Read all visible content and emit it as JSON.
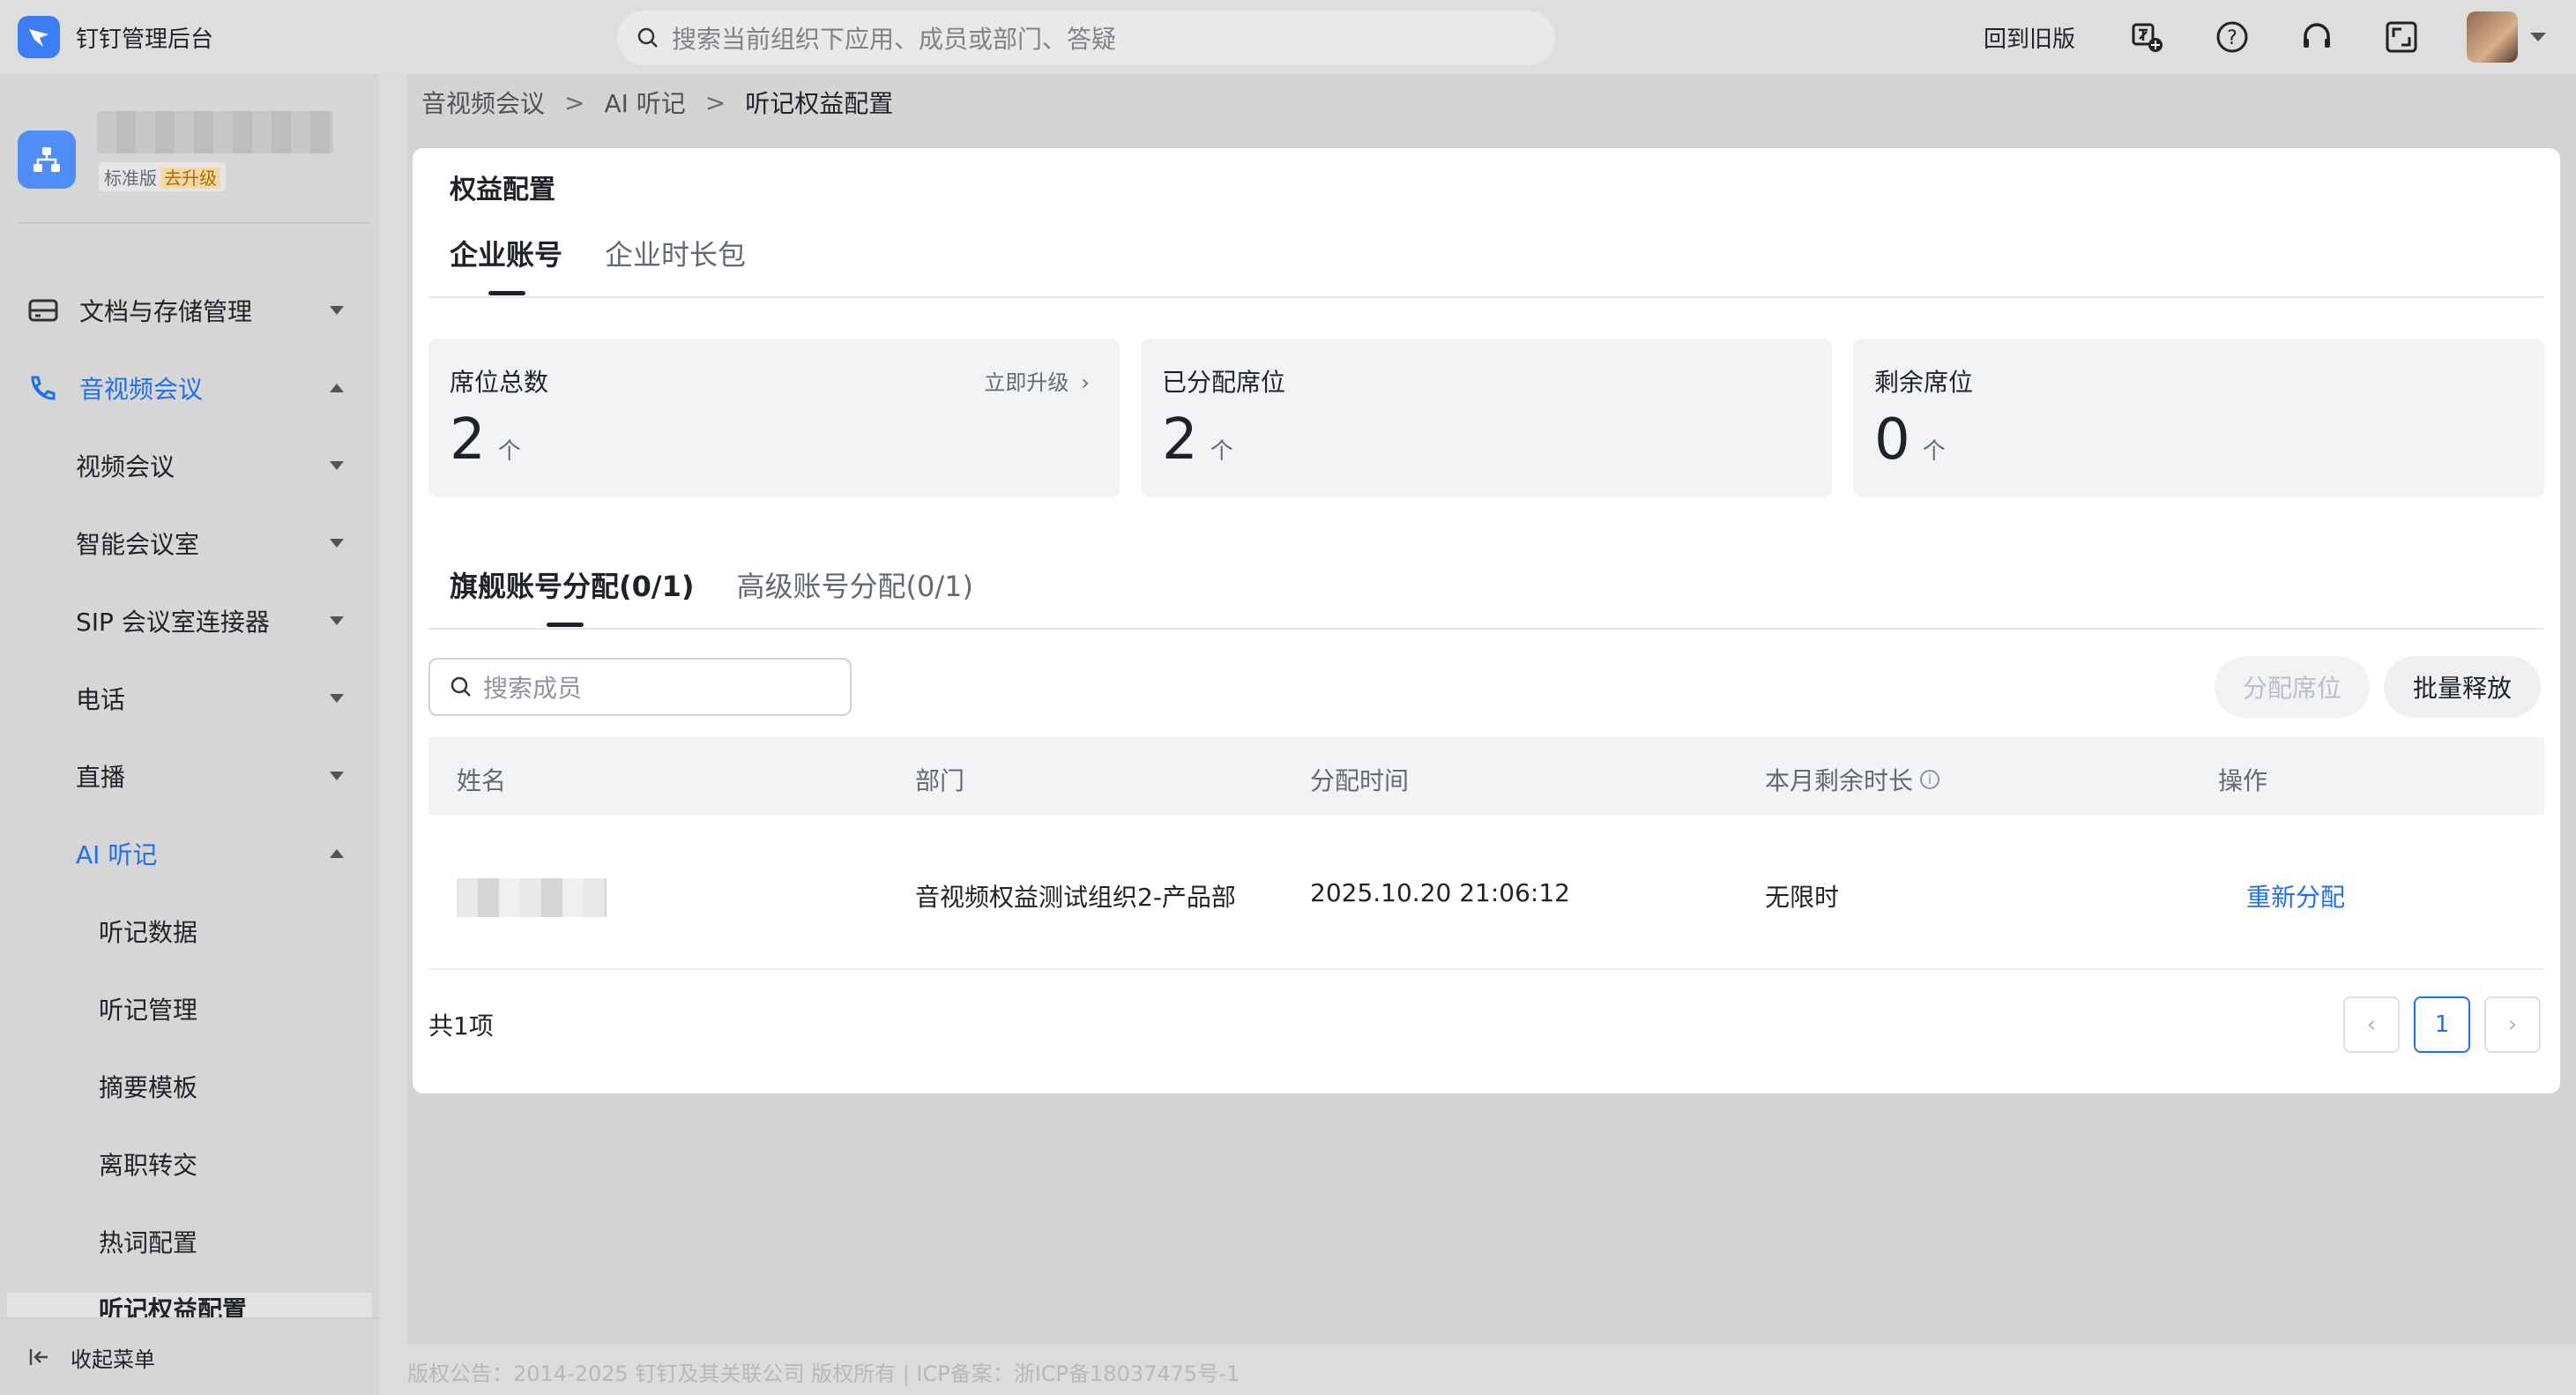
{
  "topbar": {
    "app_title": "钉钉管理后台",
    "search_placeholder": "搜索当前组织下应用、成员或部门、答疑",
    "old_version": "回到旧版"
  },
  "sidebar": {
    "plan_label": "标准版",
    "upgrade_label": "去升级",
    "items": [
      {
        "label": "文档与存储管理"
      },
      {
        "label": "音视频会议"
      },
      {
        "label": "视频会议"
      },
      {
        "label": "智能会议室"
      },
      {
        "label": "SIP 会议室连接器"
      },
      {
        "label": "电话"
      },
      {
        "label": "直播"
      },
      {
        "label": "AI 听记"
      },
      {
        "label": "听记数据"
      },
      {
        "label": "听记管理"
      },
      {
        "label": "摘要模板"
      },
      {
        "label": "离职转交"
      },
      {
        "label": "热词配置"
      },
      {
        "label": "听记权益配置"
      }
    ],
    "collapse_label": "收起菜单"
  },
  "breadcrumb": [
    "音视频会议",
    "AI 听记",
    "听记权益配置"
  ],
  "card": {
    "title": "权益配置",
    "tabs": [
      "企业账号",
      "企业时长包"
    ],
    "stats": [
      {
        "title": "席位总数",
        "value": "2",
        "unit": "个",
        "link": "立即升级"
      },
      {
        "title": "已分配席位",
        "value": "2",
        "unit": "个"
      },
      {
        "title": "剩余席位",
        "value": "0",
        "unit": "个"
      }
    ],
    "sub_tabs": [
      "旗舰账号分配(0/1)",
      "高级账号分配(0/1)"
    ],
    "search_placeholder": "搜索成员",
    "btn_assign": "分配席位",
    "btn_release": "批量释放",
    "columns": [
      "姓名",
      "部门",
      "分配时间",
      "本月剩余时长",
      "操作"
    ],
    "rows": [
      {
        "dept": "音视频权益测试组织2-产品部",
        "time": "2025.10.20 21:06:12",
        "remaining": "无限时",
        "action": "重新分配"
      }
    ],
    "total": "共1项",
    "page": "1"
  },
  "footer": "版权公告：2014-2025 钉钉及其关联公司 版权所有 | ICP备案：浙ICP备18037475号-1"
}
